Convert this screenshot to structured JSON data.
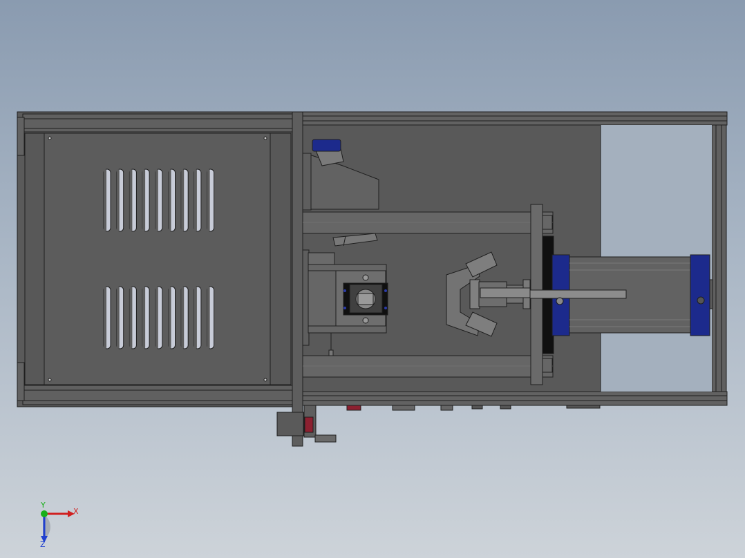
{
  "viewport": {
    "background_top": "#8a9bb0",
    "background_bottom": "#cdd3d9"
  },
  "model": {
    "body_color": "#5c5c5c",
    "edge_color": "#1e1e1e",
    "accent_blue": "#1c2a8c",
    "accent_red": "#8c2030",
    "vent_color": "#c8ccd8"
  },
  "triad": {
    "x_label": "X",
    "y_label": "Y",
    "z_label": "Z",
    "x_color": "#d02020",
    "y_color": "#18b018",
    "z_color": "#2040d0"
  }
}
